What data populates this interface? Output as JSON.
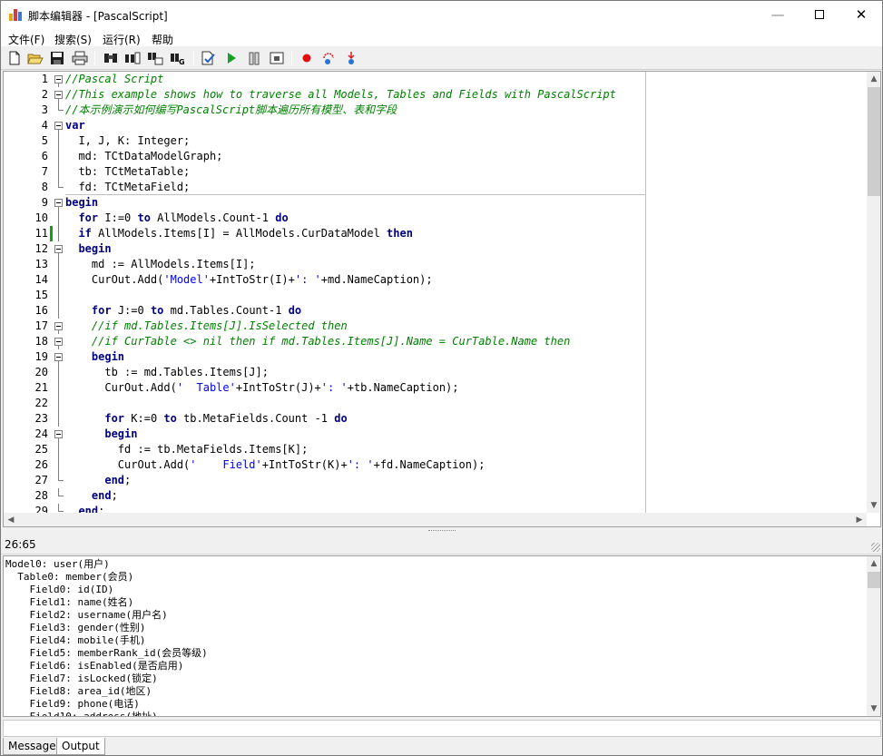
{
  "window": {
    "title": "脚本编辑器 - [PascalScript]",
    "controls": {
      "minimize": "—",
      "close": "✕"
    }
  },
  "menu": [
    {
      "label": "文件(F)"
    },
    {
      "label": "搜索(S)"
    },
    {
      "label": "运行(R)"
    },
    {
      "label": "帮助"
    }
  ],
  "toolbar": [
    "new-file-icon",
    "open-folder-icon",
    "save-icon",
    "print-preview-icon",
    "find-icon",
    "find-next-icon",
    "replace-icon",
    "goto-line-icon",
    "compile-icon",
    "run-icon",
    "pause-icon",
    "stop-icon",
    "breakpoint-icon",
    "step-over-icon",
    "step-into-icon"
  ],
  "editor": {
    "lines": [
      {
        "n": "1",
        "fold": "box",
        "tokens": [
          {
            "t": "cm",
            "v": "//Pascal Script"
          }
        ]
      },
      {
        "n": "2",
        "fold": "box",
        "tokens": [
          {
            "t": "cm",
            "v": "//This example shows how to traverse all Models, Tables and Fields with PascalScript"
          }
        ]
      },
      {
        "n": "3",
        "fold": "end",
        "tokens": [
          {
            "t": "cm",
            "v": "//本示例演示如何编写PascalScript脚本遍历所有模型、表和字段"
          }
        ]
      },
      {
        "n": "4",
        "fold": "box",
        "tokens": [
          {
            "t": "kw",
            "v": "var"
          }
        ]
      },
      {
        "n": "5",
        "fold": "line",
        "tokens": [
          {
            "t": "pl",
            "v": "  I, J, K: Integer;"
          }
        ]
      },
      {
        "n": "6",
        "fold": "line",
        "tokens": [
          {
            "t": "pl",
            "v": "  md: TCtDataModelGraph;"
          }
        ]
      },
      {
        "n": "7",
        "fold": "line",
        "tokens": [
          {
            "t": "pl",
            "v": "  tb: TCtMetaTable;"
          }
        ]
      },
      {
        "n": "8",
        "fold": "end",
        "tokens": [
          {
            "t": "pl",
            "v": "  fd: TCtMetaField;"
          }
        ]
      },
      {
        "n": "9",
        "fold": "box",
        "tokens": [
          {
            "t": "kw",
            "v": "begin"
          }
        ]
      },
      {
        "n": "10",
        "fold": "line",
        "tokens": [
          {
            "t": "pl",
            "v": "  "
          },
          {
            "t": "kw",
            "v": "for"
          },
          {
            "t": "pl",
            "v": " I:=0 "
          },
          {
            "t": "kw",
            "v": "to"
          },
          {
            "t": "pl",
            "v": " AllModels.Count-1 "
          },
          {
            "t": "kw",
            "v": "do"
          }
        ]
      },
      {
        "n": "11",
        "fold": "line",
        "mod": true,
        "tokens": [
          {
            "t": "pl",
            "v": "  "
          },
          {
            "t": "kw",
            "v": "if"
          },
          {
            "t": "pl",
            "v": " AllModels.Items[I] = AllModels.CurDataModel "
          },
          {
            "t": "kw",
            "v": "then"
          }
        ]
      },
      {
        "n": "12",
        "fold": "box",
        "tokens": [
          {
            "t": "pl",
            "v": "  "
          },
          {
            "t": "kw",
            "v": "begin"
          }
        ]
      },
      {
        "n": "13",
        "fold": "line",
        "tokens": [
          {
            "t": "pl",
            "v": "    md := AllModels.Items[I];"
          }
        ]
      },
      {
        "n": "14",
        "fold": "line",
        "tokens": [
          {
            "t": "pl",
            "v": "    CurOut.Add("
          },
          {
            "t": "st",
            "v": "'Model'"
          },
          {
            "t": "pl",
            "v": "+IntToStr(I)+"
          },
          {
            "t": "st",
            "v": "': '"
          },
          {
            "t": "pl",
            "v": "+md.NameCaption);"
          }
        ]
      },
      {
        "n": "15",
        "fold": "line",
        "tokens": [
          {
            "t": "pl",
            "v": ""
          }
        ]
      },
      {
        "n": "16",
        "fold": "line",
        "tokens": [
          {
            "t": "pl",
            "v": "    "
          },
          {
            "t": "kw",
            "v": "for"
          },
          {
            "t": "pl",
            "v": " J:=0 "
          },
          {
            "t": "kw",
            "v": "to"
          },
          {
            "t": "pl",
            "v": " md.Tables.Count-1 "
          },
          {
            "t": "kw",
            "v": "do"
          }
        ]
      },
      {
        "n": "17",
        "fold": "box",
        "tokens": [
          {
            "t": "pl",
            "v": "    "
          },
          {
            "t": "cm",
            "v": "//if md.Tables.Items[J].IsSelected then"
          }
        ]
      },
      {
        "n": "18",
        "fold": "box",
        "tokens": [
          {
            "t": "pl",
            "v": "    "
          },
          {
            "t": "cm",
            "v": "//if CurTable <> nil then if md.Tables.Items[J].Name = CurTable.Name then"
          }
        ]
      },
      {
        "n": "19",
        "fold": "box",
        "tokens": [
          {
            "t": "pl",
            "v": "    "
          },
          {
            "t": "kw",
            "v": "begin"
          }
        ]
      },
      {
        "n": "20",
        "fold": "line",
        "tokens": [
          {
            "t": "pl",
            "v": "      tb := md.Tables.Items[J];"
          }
        ]
      },
      {
        "n": "21",
        "fold": "line",
        "tokens": [
          {
            "t": "pl",
            "v": "      CurOut.Add("
          },
          {
            "t": "st",
            "v": "'  Table'"
          },
          {
            "t": "pl",
            "v": "+IntToStr(J)+"
          },
          {
            "t": "st",
            "v": "': '"
          },
          {
            "t": "pl",
            "v": "+tb.NameCaption);"
          }
        ]
      },
      {
        "n": "22",
        "fold": "line",
        "tokens": [
          {
            "t": "pl",
            "v": ""
          }
        ]
      },
      {
        "n": "23",
        "fold": "line",
        "tokens": [
          {
            "t": "pl",
            "v": "      "
          },
          {
            "t": "kw",
            "v": "for"
          },
          {
            "t": "pl",
            "v": " K:=0 "
          },
          {
            "t": "kw",
            "v": "to"
          },
          {
            "t": "pl",
            "v": " tb.MetaFields.Count -1 "
          },
          {
            "t": "kw",
            "v": "do"
          }
        ]
      },
      {
        "n": "24",
        "fold": "box",
        "tokens": [
          {
            "t": "pl",
            "v": "      "
          },
          {
            "t": "kw",
            "v": "begin"
          }
        ]
      },
      {
        "n": "25",
        "fold": "line",
        "tokens": [
          {
            "t": "pl",
            "v": "        fd := tb.MetaFields.Items[K];"
          }
        ]
      },
      {
        "n": "26",
        "fold": "line",
        "tokens": [
          {
            "t": "pl",
            "v": "        CurOut.Add("
          },
          {
            "t": "st",
            "v": "'    Field'"
          },
          {
            "t": "pl",
            "v": "+IntToStr(K)+"
          },
          {
            "t": "st",
            "v": "': '"
          },
          {
            "t": "pl",
            "v": "+fd.NameCaption);"
          }
        ]
      },
      {
        "n": "27",
        "fold": "end",
        "tokens": [
          {
            "t": "pl",
            "v": "      "
          },
          {
            "t": "kw",
            "v": "end"
          },
          {
            "t": "pl",
            "v": ";"
          }
        ]
      },
      {
        "n": "28",
        "fold": "end",
        "tokens": [
          {
            "t": "pl",
            "v": "    "
          },
          {
            "t": "kw",
            "v": "end"
          },
          {
            "t": "pl",
            "v": ";"
          }
        ]
      },
      {
        "n": "29",
        "fold": "end",
        "tokens": [
          {
            "t": "pl",
            "v": "  "
          },
          {
            "t": "kw",
            "v": "end"
          },
          {
            "t": "pl",
            "v": ";"
          }
        ]
      }
    ]
  },
  "status": {
    "cursor": "26:65"
  },
  "output": {
    "lines": [
      "Model0: user(用户)",
      "  Table0: member(会员)",
      "    Field0: id(ID)",
      "    Field1: name(姓名)",
      "    Field2: username(用户名)",
      "    Field3: gender(性别)",
      "    Field4: mobile(手机)",
      "    Field5: memberRank_id(会员等级)",
      "    Field6: isEnabled(是否启用)",
      "    Field7: isLocked(锁定)",
      "    Field8: area_id(地区)",
      "    Field9: phone(电话)",
      "    Field10: address(地址)"
    ]
  },
  "tabs": [
    {
      "label": "Messages"
    },
    {
      "label": "Output"
    }
  ],
  "colors": {
    "keyword": "#000080",
    "comment": "#008000",
    "string": "#0000ff",
    "modified_marker": "#13a10e"
  }
}
